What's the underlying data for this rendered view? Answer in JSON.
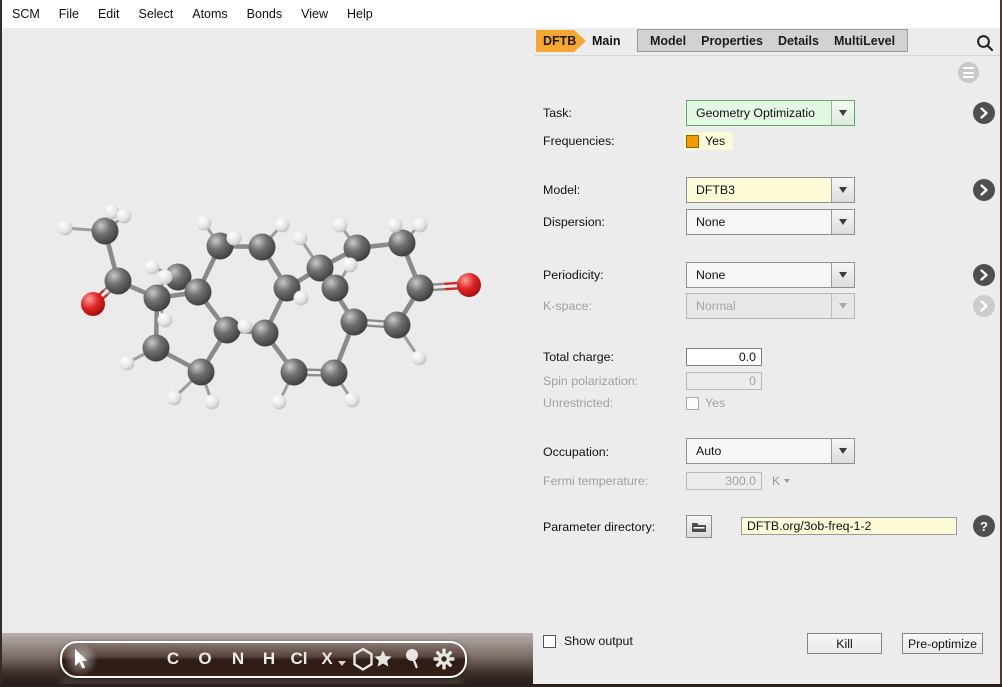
{
  "menu_bar": {
    "items": [
      "SCM",
      "File",
      "Edit",
      "Select",
      "Atoms",
      "Bonds",
      "View",
      "Help"
    ]
  },
  "tab_bar": {
    "module_tag": "DFTB",
    "active_tab": "Main",
    "tabs": [
      "Model",
      "Properties",
      "Details",
      "MultiLevel"
    ]
  },
  "icons": {
    "help": "?"
  },
  "panel": {
    "task": {
      "label": "Task:",
      "value": "Geometry Optimizatio"
    },
    "frequencies": {
      "label": "Frequencies:",
      "value": "Yes",
      "checked": true
    },
    "model": {
      "label": "Model:",
      "value": "DFTB3"
    },
    "dispersion": {
      "label": "Dispersion:",
      "value": "None"
    },
    "periodicity": {
      "label": "Periodicity:",
      "value": "None"
    },
    "kspace": {
      "label": "K-space:",
      "value": "Normal",
      "disabled": true
    },
    "total_charge": {
      "label": "Total charge:",
      "value": "0.0"
    },
    "spin_polarization": {
      "label": "Spin polarization:",
      "value": "0",
      "disabled": true
    },
    "unrestricted": {
      "label": "Unrestricted:",
      "value": "Yes",
      "checked": false,
      "disabled": true
    },
    "occupation": {
      "label": "Occupation:",
      "value": "Auto"
    },
    "fermi_temperature": {
      "label": "Fermi temperature:",
      "value": "300.0",
      "unit": "K",
      "disabled": true
    },
    "parameter_directory": {
      "label": "Parameter directory:",
      "value": "DFTB.org/3ob-freq-1-2"
    }
  },
  "footer": {
    "show_output": "Show output",
    "kill": "Kill",
    "preoptimize": "Pre-optimize"
  },
  "colors": {
    "accent_orange": "#f4a732",
    "task_highlight": "#e3f8e3",
    "model_highlight": "#fdfad8",
    "checkbox_orange": "#f59d00",
    "panel_bg": "#ececec",
    "viewer_bg": "#ebebeb",
    "carbon": "#4a4a4a",
    "oxygen": "#d42020",
    "hydrogen": "#e8e8e8"
  },
  "viewer": {
    "toolbar": {
      "elements": [
        "C",
        "O",
        "N",
        "H",
        "Cl",
        "X"
      ],
      "tools": [
        "pointer",
        "ring",
        "star",
        "balloon",
        "gear"
      ]
    },
    "molecule": {
      "atoms": [
        [
          "C",
          103,
          231
        ],
        [
          "C",
          116,
          281
        ],
        [
          "O",
          91,
          304
        ],
        [
          "C",
          155,
          298
        ],
        [
          "C",
          176,
          277
        ],
        [
          "C",
          196,
          292
        ],
        [
          "C",
          154,
          348
        ],
        [
          "C",
          199,
          372
        ],
        [
          "C",
          225,
          330
        ],
        [
          "C",
          218,
          246
        ],
        [
          "C",
          260,
          247
        ],
        [
          "C",
          285,
          288
        ],
        [
          "C",
          263,
          333
        ],
        [
          "C",
          292,
          372
        ],
        [
          "C",
          332,
          373
        ],
        [
          "C",
          352,
          322
        ],
        [
          "C",
          318,
          268
        ],
        [
          "C",
          333,
          288
        ],
        [
          "C",
          355,
          248
        ],
        [
          "C",
          400,
          243
        ],
        [
          "C",
          418,
          288
        ],
        [
          "C",
          395,
          325
        ],
        [
          "O",
          467,
          285
        ],
        [
          "H",
          110,
          212
        ],
        [
          "H",
          63,
          228
        ],
        [
          "H",
          122,
          216
        ],
        [
          "H",
          163,
          277
        ],
        [
          "H",
          163,
          320
        ],
        [
          "H",
          150,
          267
        ],
        [
          "H",
          125,
          363
        ],
        [
          "H",
          210,
          402
        ],
        [
          "H",
          172,
          398
        ],
        [
          "H",
          202,
          223
        ],
        [
          "H",
          232,
          238
        ],
        [
          "H",
          280,
          225
        ],
        [
          "H",
          299,
          298
        ],
        [
          "H",
          243,
          326
        ],
        [
          "H",
          277,
          402
        ],
        [
          "H",
          350,
          400
        ],
        [
          "H",
          338,
          225
        ],
        [
          "H",
          298,
          238
        ],
        [
          "H",
          348,
          265
        ],
        [
          "H",
          393,
          225
        ],
        [
          "H",
          418,
          225
        ],
        [
          "H",
          417,
          358
        ]
      ],
      "bonds": [
        [
          0,
          1
        ],
        [
          1,
          2,
          2
        ],
        [
          1,
          3
        ],
        [
          3,
          5
        ],
        [
          3,
          6
        ],
        [
          6,
          7
        ],
        [
          7,
          8
        ],
        [
          8,
          5
        ],
        [
          5,
          4
        ],
        [
          5,
          9
        ],
        [
          9,
          10
        ],
        [
          10,
          11
        ],
        [
          11,
          12
        ],
        [
          12,
          8
        ],
        [
          11,
          16
        ],
        [
          12,
          13
        ],
        [
          13,
          14,
          2
        ],
        [
          14,
          15
        ],
        [
          15,
          16
        ],
        [
          15,
          21,
          2
        ],
        [
          21,
          20
        ],
        [
          20,
          22,
          2
        ],
        [
          20,
          19
        ],
        [
          19,
          18
        ],
        [
          18,
          16
        ],
        [
          16,
          17
        ],
        [
          0,
          23
        ],
        [
          0,
          24
        ],
        [
          0,
          25
        ],
        [
          3,
          26
        ],
        [
          3,
          27
        ],
        [
          4,
          28
        ],
        [
          6,
          29
        ],
        [
          7,
          30
        ],
        [
          7,
          31
        ],
        [
          9,
          32
        ],
        [
          9,
          33
        ],
        [
          10,
          34
        ],
        [
          11,
          35
        ],
        [
          8,
          36
        ],
        [
          13,
          37
        ],
        [
          14,
          38
        ],
        [
          18,
          39
        ],
        [
          16,
          40
        ],
        [
          17,
          41
        ],
        [
          19,
          42
        ],
        [
          19,
          43
        ],
        [
          21,
          44
        ]
      ]
    }
  }
}
